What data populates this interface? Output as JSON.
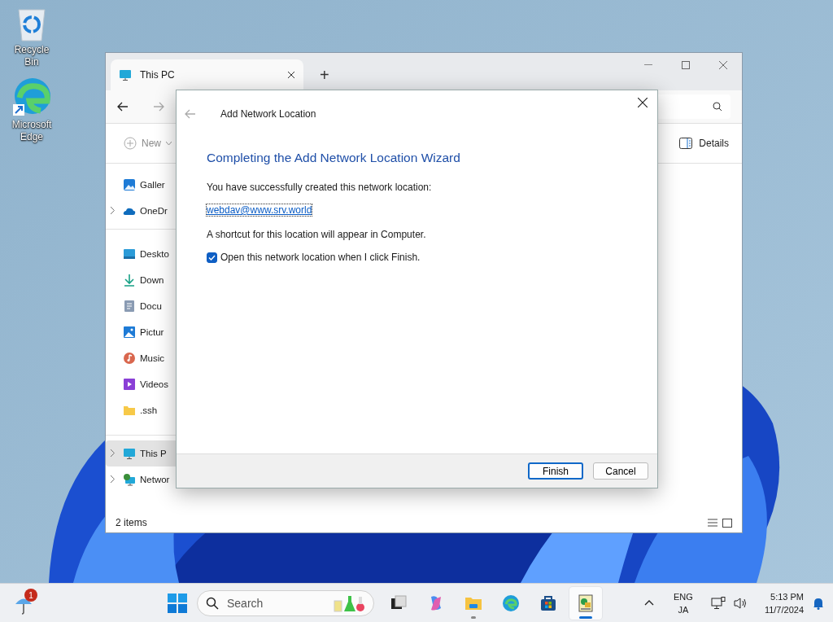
{
  "desktop_icons": [
    {
      "kind": "recycle",
      "label": "Recycle Bin"
    },
    {
      "kind": "edge",
      "label": "Microsoft Edge"
    }
  ],
  "explorer": {
    "tab": {
      "title": "This PC",
      "selected": true
    },
    "new_tab": "+",
    "toolbar": {
      "new": "New",
      "details": "Details"
    },
    "sidebar": [
      {
        "items": [
          {
            "kind": "gallery",
            "label": "Galler",
            "expandable": false,
            "selected": false
          },
          {
            "kind": "cloud",
            "label": "OneDr",
            "expandable": true,
            "selected": false
          }
        ]
      },
      {
        "items": [
          {
            "kind": "desktop",
            "label": "Deskto",
            "expandable": false,
            "selected": false
          },
          {
            "kind": "download",
            "label": "Down",
            "expandable": false,
            "selected": false
          },
          {
            "kind": "document",
            "label": "Docu",
            "expandable": false,
            "selected": false
          },
          {
            "kind": "pictures",
            "label": "Pictur",
            "expandable": false,
            "selected": false
          },
          {
            "kind": "music",
            "label": "Music",
            "expandable": false,
            "selected": false
          },
          {
            "kind": "videos",
            "label": "Videos",
            "expandable": false,
            "selected": false
          },
          {
            "kind": "folder",
            "label": ".ssh",
            "expandable": false,
            "selected": false
          }
        ]
      },
      {
        "items": [
          {
            "kind": "pc",
            "label": "This P",
            "expandable": true,
            "selected": true
          },
          {
            "kind": "network",
            "label": "Networ",
            "expandable": true,
            "selected": false
          }
        ]
      }
    ],
    "status_bar": "2 items"
  },
  "dialog": {
    "title": "Add Network Location",
    "heading": "Completing the Add Network Location Wizard",
    "message": "You have successfully created this network location:",
    "link": "webdav@www.srv.world",
    "note": "A shortcut for this location will appear in Computer.",
    "checkbox": {
      "label": "Open this network location when I click Finish.",
      "checked": true
    },
    "buttons": [
      {
        "label": "Finish",
        "default": true
      },
      {
        "label": "Cancel",
        "default": false
      }
    ]
  },
  "taskbar": {
    "weather_badge": "1",
    "search": {
      "placeholder": "Search"
    },
    "apps": [
      {
        "kind": "taskview",
        "running": false,
        "selected": false
      },
      {
        "kind": "copilot",
        "running": false,
        "selected": false
      },
      {
        "kind": "explorer",
        "running": true,
        "selected": false
      },
      {
        "kind": "edge",
        "running": false,
        "selected": false
      },
      {
        "kind": "store",
        "running": false,
        "selected": false
      },
      {
        "kind": "wizard",
        "running": true,
        "selected": true
      }
    ],
    "language": [
      "ENG",
      "JA"
    ],
    "time": "5:13 PM",
    "date": "11/7/2024"
  }
}
